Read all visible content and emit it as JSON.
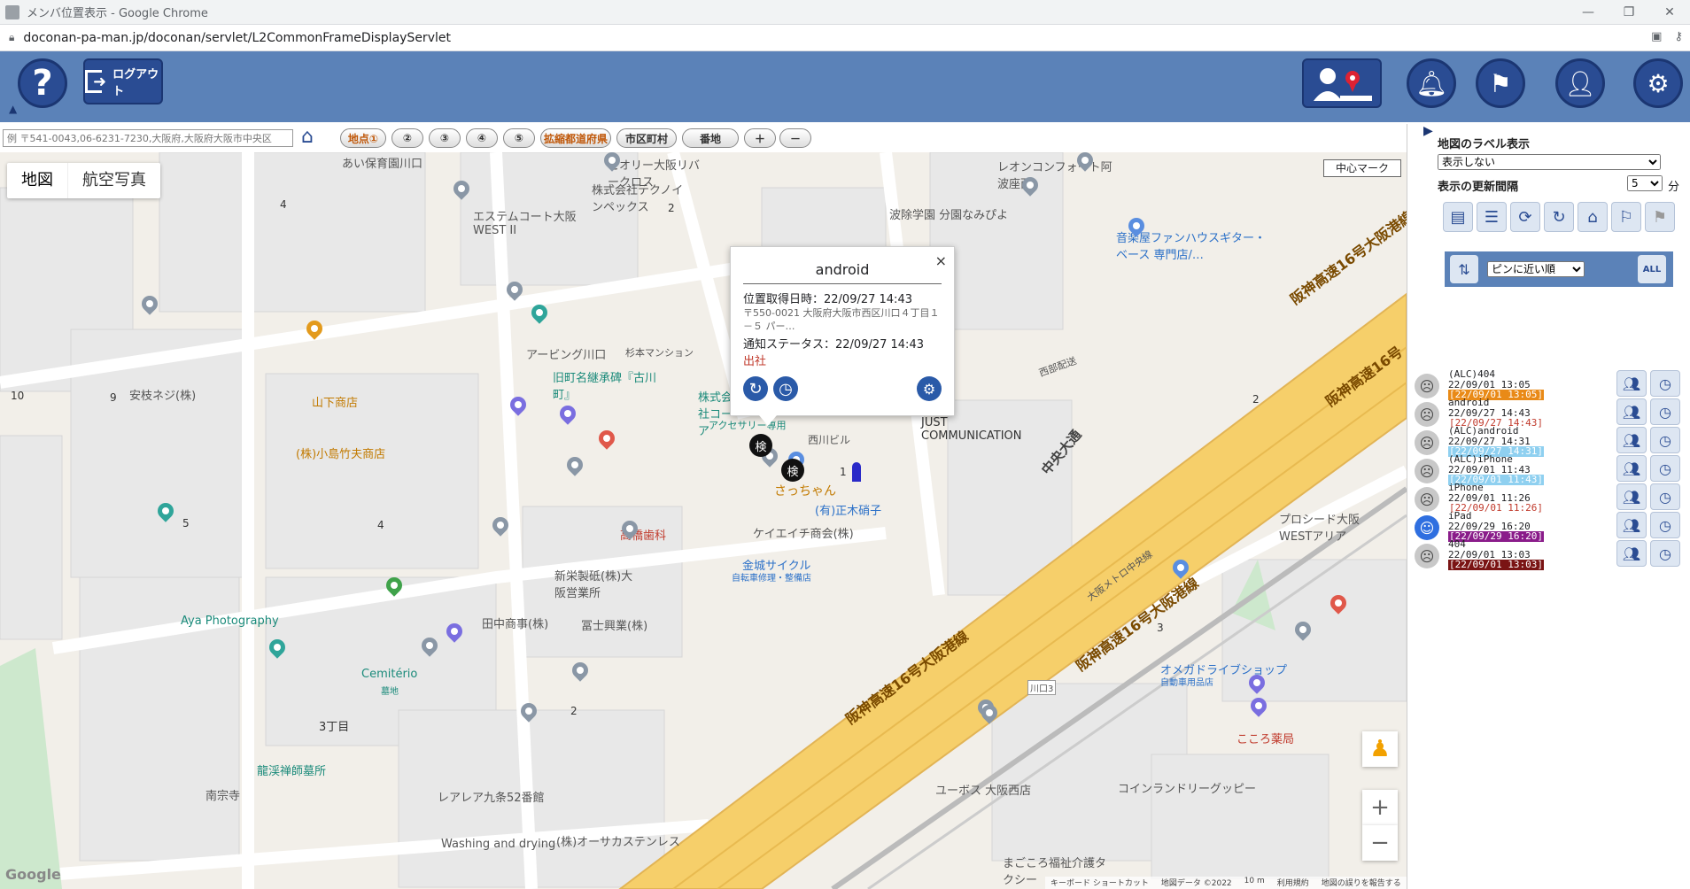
{
  "browser": {
    "title": "メンバ位置表示 - Google Chrome",
    "url": "doconan-pa-man.jp/doconan/servlet/L2CommonFrameDisplayServlet"
  },
  "header": {
    "help_label": "?",
    "logout_label": "ログアウト"
  },
  "toolbar": {
    "search_placeholder": "例 〒541-0043,06-6231-7230,大阪府,大阪府大阪市中央区",
    "buttons": [
      "地点①",
      "②",
      "③",
      "④",
      "⑤",
      "拡縮都道府県",
      "市区町村",
      "番地",
      "＋",
      "－"
    ]
  },
  "map": {
    "type_tabs": [
      "地図",
      "航空写真"
    ],
    "center_mark": "中心マーク",
    "google": "Google",
    "footer": [
      "地図データ ©2022",
      "10 m",
      "利用規約",
      "地図の誤りを報告する"
    ],
    "footer_keys": "キーボード ショートカット",
    "labels": {
      "l1": "あい保育園川口",
      "l2": "セオリー大阪リバークロス",
      "l3": "株式会社テクノインペックス",
      "l4": "レオンコンフォート阿波座西",
      "l5": "エステムコート大阪WEST II",
      "l6": "波除学園 分園なみぴよ",
      "l7": "音楽屋ファンハウスギター・ベース 専門店/…",
      "l8": "阪神高速16号大阪港線",
      "l9": "アービング川口",
      "l10": "杉本マンション",
      "l11": "旧町名継承碑『古川町』",
      "l12": "安枝ネジ(株)",
      "l13": "山下商店",
      "l14": "(株)小島竹夫商店",
      "l15": "西川ビル",
      "l16": "JUST COMMUNICATION",
      "l17": "中央大通",
      "l18": "さっちゃん",
      "l19": "(有)正木硝子",
      "l20": "高橋歯科",
      "l21": "ケイエイチ商会(株)",
      "l22": "金城サイクル",
      "l23": "自転車修理・整備店",
      "l24": "新栄製砥(株)大阪営業所",
      "l25": "冨士興業(株)",
      "l26": "田中商事(株)",
      "l27": "Aya Photography",
      "l28": "Cemitério",
      "l29": "墓地",
      "l30": "3丁目",
      "l31": "龍渓禅師墓所",
      "l32": "南宗寺",
      "l33": "レアレア九条52番館",
      "l34": "Washing and drying",
      "l35": "(株)オーサカステンレス",
      "l36": "ユーボス 大阪西店",
      "l37": "まごころ福祉介護タクシー",
      "l38": "コインランドリーグッピー",
      "l39": "オメガドライブショップ",
      "l40": "自動車用品店",
      "l41": "こころ薬局",
      "l42": "プロシード大阪WESTアリア",
      "l43": "阪神高速16号大阪港線",
      "l44": "阪神高速16号",
      "l45": "大阪メトロ中央線",
      "l46": "川口3",
      "l47": "西部配送",
      "l48": "株式会社コーア",
      "l49": "アクセサリー専用"
    },
    "numbers": [
      "4",
      "2",
      "10",
      "9",
      "5",
      "4",
      "2",
      "3",
      "2",
      "1"
    ]
  },
  "infowindow": {
    "name": "android",
    "acquired": "位置取得日時：22/09/27 14:43",
    "address": "〒550-0021 大阪府大阪市西区川口４丁目１－５ パー…",
    "status": "通知ステータス：22/09/27 14:43",
    "status_value": "出社",
    "close": "×"
  },
  "panel": {
    "label_display_title": "地図のラベル表示",
    "label_display_value": "表示しない",
    "update_interval_title": "表示の更新間隔",
    "update_interval_value": "5",
    "update_interval_unit": "分",
    "sort_value": "ピンに近い順",
    "all_label": "ALL"
  },
  "members": [
    {
      "name": "(ALC)404",
      "time": "22/09/01 13:05",
      "badge": "[22/09/01 13:05]",
      "badge_bg": "#e98a17",
      "badge_fg": "#ffffff",
      "mood": "sad"
    },
    {
      "name": "android",
      "time": "22/09/27 14:43",
      "badge": "[22/09/27 14:43]",
      "badge_bg": "#ffffff",
      "badge_fg": "#c0392b",
      "mood": "sad"
    },
    {
      "name": "(ALC)android",
      "time": "22/09/27 14:31",
      "badge": "[22/09/27 14:31]",
      "badge_bg": "#8fd0f0",
      "badge_fg": "#ffffff",
      "mood": "sad"
    },
    {
      "name": "(ALC)iPhone",
      "time": "22/09/01 11:43",
      "badge": "[22/09/01 11:43]",
      "badge_bg": "#8fd0f0",
      "badge_fg": "#ffffff",
      "mood": "sad"
    },
    {
      "name": "iPhone",
      "time": "22/09/01 11:26",
      "badge": "[22/09/01 11:26]",
      "badge_bg": "#ffffff",
      "badge_fg": "#c0392b",
      "mood": "sad"
    },
    {
      "name": "iPad",
      "time": "22/09/29 16:20",
      "badge": "[22/09/29 16:20]",
      "badge_bg": "#8a1c8a",
      "badge_fg": "#ffffff",
      "mood": "happy"
    },
    {
      "name": "404",
      "time": "22/09/01 13:03",
      "badge": "[22/09/01 13:03]",
      "badge_bg": "#7a1414",
      "badge_fg": "#ffffff",
      "mood": "sad"
    }
  ],
  "colors": {
    "header_bg": "#5b82b8",
    "button_dark": "#2a4c93",
    "highway": "#f6cf6a"
  }
}
